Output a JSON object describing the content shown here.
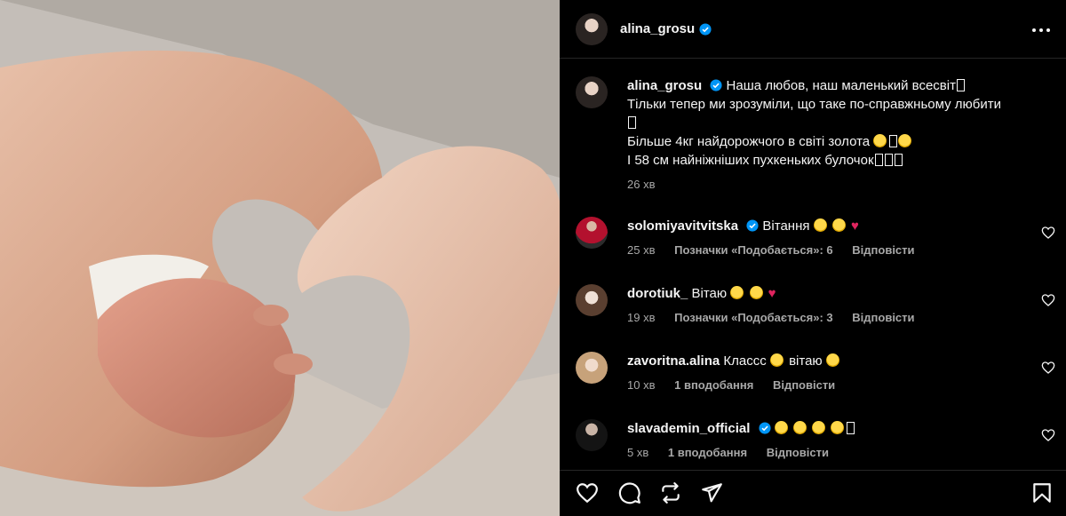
{
  "post": {
    "author": "alina_grosu",
    "caption": {
      "line1": "Наша любов, наш маленький всесвіт",
      "line2": "Тільки тепер ми зрозуміли, що таке по-справжньому любити",
      "line3": "Більше 4кг найдорожчого в світі золота",
      "line4": "І 58 см найніжніших пухкеньких булочок"
    },
    "time": "26 хв"
  },
  "comments": [
    {
      "user": "solomiyavitvitska",
      "text": "Вітання",
      "time": "25 хв",
      "likes": "Позначки «Подобається»: 6",
      "reply": "Відповісти"
    },
    {
      "user": "dorotiuk_",
      "text": "Вітаю",
      "time": "19 хв",
      "likes": "Позначки «Подобається»: 3",
      "reply": "Відповісти"
    },
    {
      "user": "zavoritna.alina",
      "text": "Классс",
      "text2": "вітаю",
      "time": "10 хв",
      "likes": "1 вподобання",
      "reply": "Відповісти"
    },
    {
      "user": "slavademin_official",
      "text": "",
      "time": "5 хв",
      "likes": "1 вподобання",
      "reply": "Відповісти"
    }
  ],
  "icons": {
    "more": "more-icon",
    "like": "heart-icon",
    "comment": "comment-icon",
    "repost": "repost-icon",
    "share": "share-icon",
    "save": "bookmark-icon",
    "verified": "verified-badge-icon"
  },
  "colors": {
    "background": "#000000",
    "text": "#f5f5f5",
    "muted": "#a8a8a8",
    "verified": "#0095f6",
    "heart": "#e0245e"
  }
}
